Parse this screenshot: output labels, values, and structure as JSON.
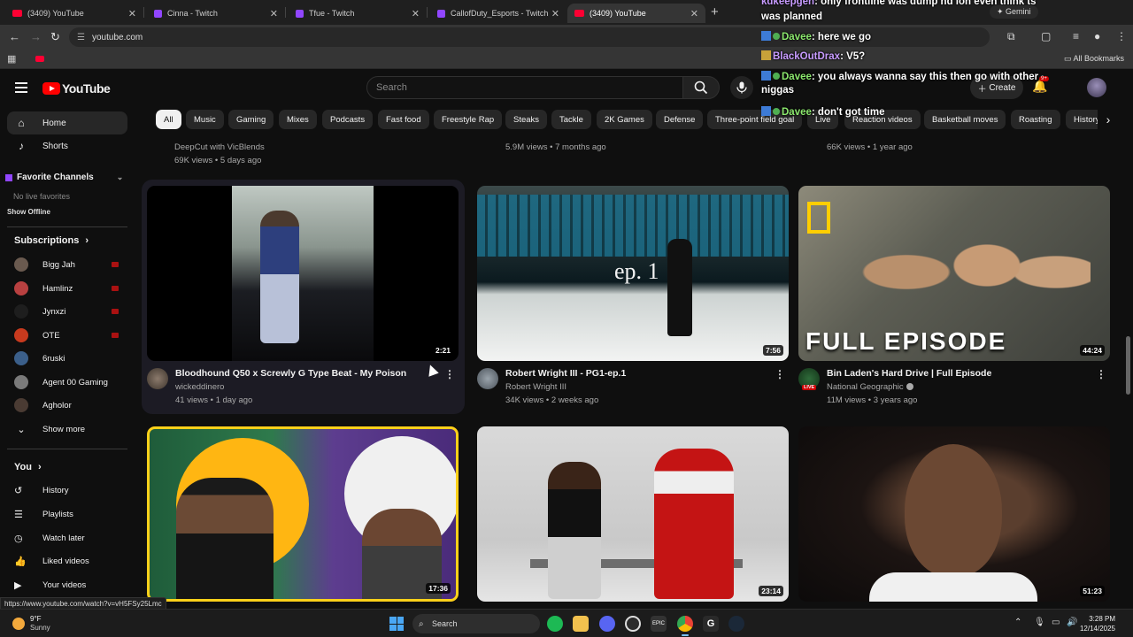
{
  "browser": {
    "tabs": [
      {
        "title": "(3409) YouTube",
        "kind": "yt"
      },
      {
        "title": "Cinna - Twitch",
        "kind": "tw"
      },
      {
        "title": "Tfue - Twitch",
        "kind": "tw"
      },
      {
        "title": "CallofDuty_Esports - Twitch",
        "kind": "tw"
      },
      {
        "title": "(3409) YouTube",
        "kind": "yt"
      }
    ],
    "url": "youtube.com",
    "all_bookmarks": "All Bookmarks",
    "gemini": "Gemini",
    "status_url": "https://www.youtube.com/watch?v=vH5FSy25Lmc"
  },
  "header": {
    "logo_text": "YouTube",
    "search_placeholder": "Search",
    "create_label": "Create",
    "notif_count": "9+"
  },
  "chips": [
    "All",
    "Music",
    "Gaming",
    "Mixes",
    "Podcasts",
    "Fast food",
    "Freestyle Rap",
    "Steaks",
    "Tackle",
    "2K Games",
    "Defense",
    "Three-point field goal",
    "Live",
    "Reaction videos",
    "Basketball moves",
    "Roasting",
    "History"
  ],
  "sidebar": {
    "home": "Home",
    "shorts": "Shorts",
    "favorite_channels": "Favorite Channels",
    "no_live": "No live favorites",
    "show_offline": "Show Offline",
    "subscriptions": "Subscriptions",
    "subs": [
      {
        "name": "Bigg Jah",
        "color": "#6a5a4f"
      },
      {
        "name": "Hamlinz",
        "color": "#b84040"
      },
      {
        "name": "Jynxzi",
        "color": "#1e1e1e"
      },
      {
        "name": "OTE",
        "color": "#c83a1e"
      },
      {
        "name": "6ruski",
        "color": "#3b5f8a"
      },
      {
        "name": "Agent 00 Gaming",
        "color": "#7a7a7a"
      },
      {
        "name": "Agholor",
        "color": "#4a3b33"
      }
    ],
    "show_more": "Show more",
    "you": "You",
    "you_items": [
      "History",
      "Playlists",
      "Watch later",
      "Liked videos",
      "Your videos"
    ]
  },
  "partial_row": [
    {
      "channel": "DeepCut with VicBlends",
      "meta": "69K views • 5 days ago"
    },
    {
      "channel": "",
      "meta": "5.9M views • 7 months ago"
    },
    {
      "channel": "",
      "meta": "66K views • 1 year ago"
    }
  ],
  "videos": [
    {
      "title": "Bloodhound Q50 x Screwly G Type Beat - My Poison",
      "channel": "wickeddinero",
      "meta": "41 views • 1 day ago",
      "duration": "2:21"
    },
    {
      "title": "Robert Wright III - PG1-ep.1",
      "channel": "Robert Wright III",
      "meta": "34K views • 2 weeks ago",
      "duration": "7:56",
      "thumb_text": "ep. 1"
    },
    {
      "title": "Bin Laden's Hard Drive | Full Episode",
      "channel": "National Geographic",
      "meta": "11M views • 3 years ago",
      "duration": "44:24",
      "thumb_text": "FULL EPISODE",
      "live_badge": "LIVE"
    },
    {
      "duration": "17:36"
    },
    {
      "duration": "23:14"
    },
    {
      "duration": "51:23"
    }
  ],
  "chat": [
    {
      "user": "kdkeepgen",
      "msg": ": only frontline was dump nd ion even think ts"
    },
    {
      "user": "",
      "msg": "was planned"
    },
    {
      "user": "Davee",
      "msg": ": here we go"
    },
    {
      "user": "BlackOutDrax",
      "msg": ": V5?"
    },
    {
      "user": "Davee",
      "msg": ": you always wanna say this then go with other"
    },
    {
      "user": "",
      "msg": "niggas"
    },
    {
      "user": "Davee",
      "msg": ": don't got time"
    }
  ],
  "taskbar": {
    "temp": "9°F",
    "weather": "Sunny",
    "search": "Search",
    "time": "3:28 PM",
    "date": "12/14/2025"
  }
}
